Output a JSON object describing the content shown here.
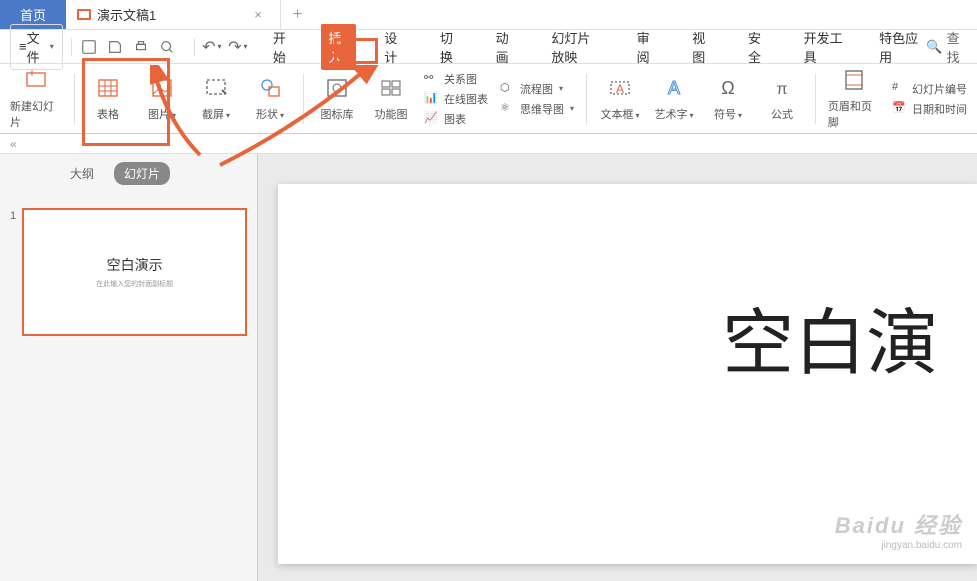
{
  "tabs": {
    "home": "首页",
    "doc": "演示文稿1"
  },
  "file_menu": "文件",
  "menu": {
    "start": "开始",
    "insert": "插入",
    "design": "设计",
    "transition": "切换",
    "animation": "动画",
    "slideshow": "幻灯片放映",
    "review": "审阅",
    "view": "视图",
    "security": "安全",
    "dev": "开发工具",
    "special": "特色应用"
  },
  "search": "查找",
  "ribbon": {
    "new_slide": "新建幻灯片",
    "table": "表格",
    "picture": "图片",
    "screenshot": "截屏",
    "shape": "形状",
    "icon_lib": "图标库",
    "feature_img": "功能图",
    "relation": "关系图",
    "online_chart": "在线图表",
    "chart": "图表",
    "flowchart": "流程图",
    "mindmap": "思维导图",
    "textbox": "文本框",
    "wordart": "艺术字",
    "symbol": "符号",
    "formula": "公式",
    "header_footer": "页眉和页脚",
    "slide_number": "幻灯片编号",
    "datetime": "日期和时间"
  },
  "panel": {
    "outline": "大纲",
    "slides": "幻灯片",
    "num": "1",
    "thumb_title": "空白演示",
    "thumb_sub": "在此输入您的封面副标题"
  },
  "canvas": {
    "title": "空白演"
  },
  "watermark": {
    "main": "Baidu 经验",
    "sub": "jingyan.baidu.com"
  }
}
